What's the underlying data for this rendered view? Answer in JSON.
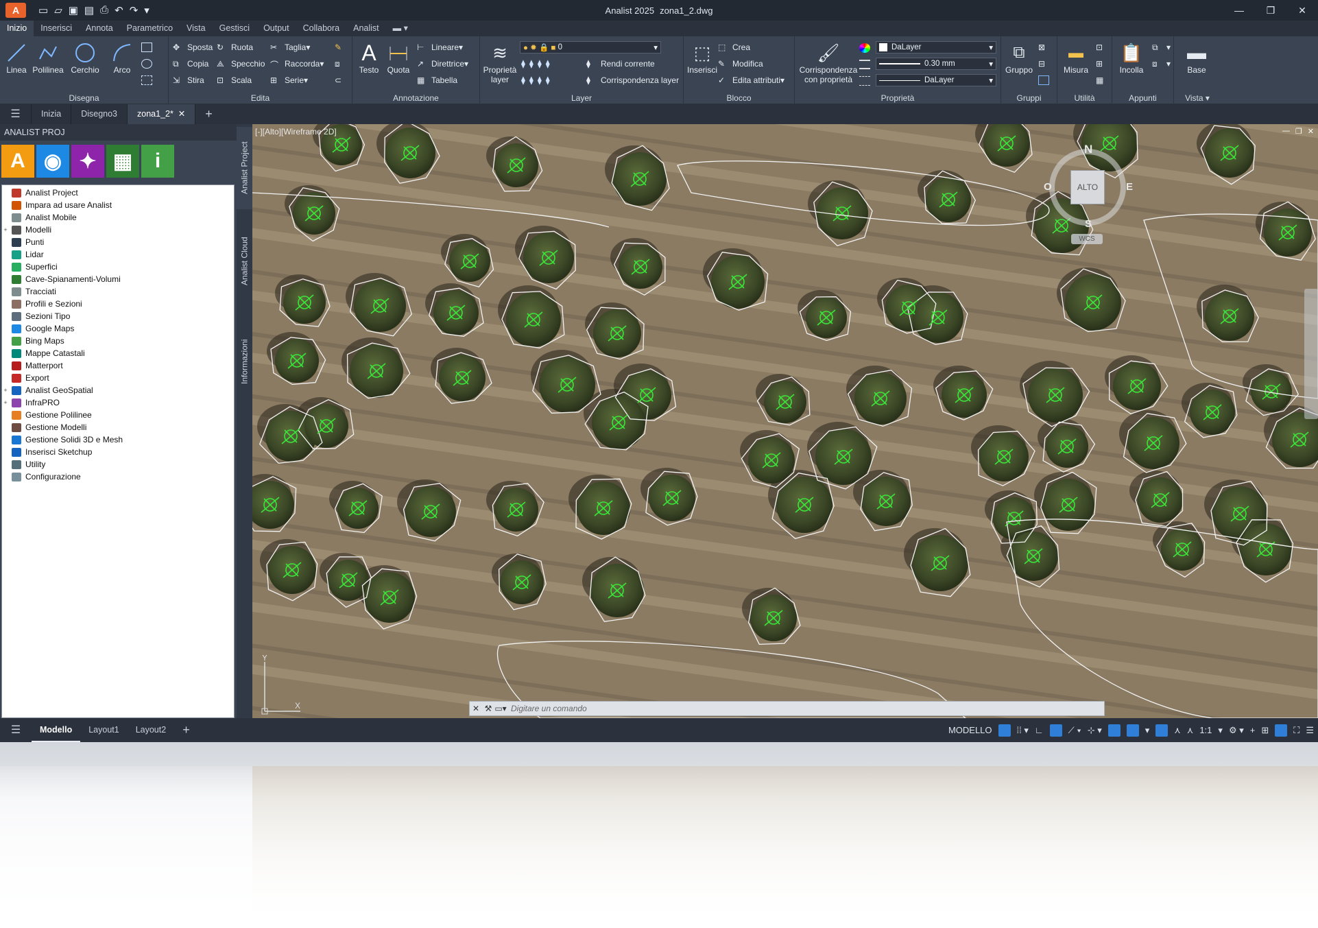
{
  "window": {
    "app_title": "Analist 2025",
    "file_name": "zona1_2.dwg"
  },
  "menu": {
    "tabs": [
      "Inizio",
      "Inserisci",
      "Annota",
      "Parametrico",
      "Vista",
      "Gestisci",
      "Output",
      "Collabora",
      "Analist"
    ]
  },
  "ribbon": {
    "draw": {
      "title": "Disegna",
      "linea": "Linea",
      "polilinea": "Polilinea",
      "cerchio": "Cerchio",
      "arco": "Arco"
    },
    "edit": {
      "title": "Edita",
      "sposta": "Sposta",
      "ruota": "Ruota",
      "taglia": "Taglia",
      "copia": "Copia",
      "specchio": "Specchio",
      "raccorda": "Raccorda",
      "stira": "Stira",
      "scala": "Scala",
      "serie": "Serie"
    },
    "annotation": {
      "title": "Annotazione",
      "testo": "Testo",
      "quota": "Quota",
      "lineare": "Lineare",
      "direttrice": "Direttrice",
      "tabella": "Tabella"
    },
    "layer": {
      "title": "Layer",
      "proprieta_layer_1": "Proprietà",
      "proprieta_layer_2": "layer",
      "current": "0",
      "rendi_corrente": "Rendi corrente",
      "corrispondenza": "Corrispondenza layer"
    },
    "block": {
      "title": "Blocco",
      "inserisci": "Inserisci",
      "crea": "Crea",
      "modifica": "Modifica",
      "edita_attributi": "Edita attributi"
    },
    "props": {
      "title": "Proprietà",
      "corr_1": "Corrispondenza",
      "corr_2": "con proprietà",
      "color": "DaLayer",
      "lineweight": "0.30 mm",
      "linetype": "DaLayer"
    },
    "groups": {
      "title": "Gruppi",
      "gruppo": "Gruppo"
    },
    "utility": {
      "title": "Utilità",
      "misura": "Misura"
    },
    "clipboard": {
      "title": "Appunti",
      "incolla": "Incolla"
    },
    "view": {
      "title": "Vista",
      "base": "Base"
    }
  },
  "doctabs": [
    "Inizia",
    "Disegno3",
    "zona1_2*"
  ],
  "leftpanel": {
    "title": "ANALIST PROJ",
    "tree": [
      {
        "label": "Analist Project",
        "color": "#c0392b",
        "expand": ""
      },
      {
        "label": "Impara ad usare Analist",
        "color": "#d35400",
        "expand": ""
      },
      {
        "label": "Analist Mobile",
        "color": "#7f8c8d",
        "expand": ""
      },
      {
        "label": "Modelli",
        "color": "#555555",
        "expand": "+"
      },
      {
        "label": "Punti",
        "color": "#2c3e50",
        "expand": ""
      },
      {
        "label": "Lidar",
        "color": "#16a085",
        "expand": ""
      },
      {
        "label": "Superfici",
        "color": "#27ae60",
        "expand": ""
      },
      {
        "label": "Cave-Spianamenti-Volumi",
        "color": "#2e7d32",
        "expand": ""
      },
      {
        "label": "Tracciati",
        "color": "#7f8c8d",
        "expand": ""
      },
      {
        "label": "Profili e Sezioni",
        "color": "#8d6e63",
        "expand": ""
      },
      {
        "label": "Sezioni Tipo",
        "color": "#5d6d7e",
        "expand": ""
      },
      {
        "label": "Google Maps",
        "color": "#1e88e5",
        "expand": ""
      },
      {
        "label": "Bing Maps",
        "color": "#43a047",
        "expand": ""
      },
      {
        "label": "Mappe Catastali",
        "color": "#00897b",
        "expand": ""
      },
      {
        "label": "Matterport",
        "color": "#b71c1c",
        "expand": ""
      },
      {
        "label": "Export",
        "color": "#c62828",
        "expand": ""
      },
      {
        "label": "Analist GeoSpatial",
        "color": "#1565c0",
        "expand": "+"
      },
      {
        "label": "InfraPRO",
        "color": "#8e44ad",
        "expand": "+"
      },
      {
        "label": "Gestione Polilinee",
        "color": "#e67e22",
        "expand": ""
      },
      {
        "label": "Gestione Modelli",
        "color": "#6d4c41",
        "expand": ""
      },
      {
        "label": "Gestione Solidi 3D e Mesh",
        "color": "#1976d2",
        "expand": ""
      },
      {
        "label": "Inserisci Sketchup",
        "color": "#1565c0",
        "expand": ""
      },
      {
        "label": "Utility",
        "color": "#546e7a",
        "expand": ""
      },
      {
        "label": "Configurazione",
        "color": "#78909c",
        "expand": ""
      }
    ],
    "icons": [
      {
        "name": "analist-a-icon",
        "label": "A",
        "color": "#f39c12"
      },
      {
        "name": "globe-icon",
        "label": "◉",
        "color": "#1e88e5"
      },
      {
        "name": "satellite-icon",
        "label": "✦",
        "color": "#8e24aa"
      },
      {
        "name": "map-icon",
        "label": "▦",
        "color": "#2e7d32"
      },
      {
        "name": "info-icon",
        "label": "i",
        "color": "#43a047"
      }
    ]
  },
  "sidetabs": [
    "Analist Project",
    "Analist Cloud",
    "Informazioni"
  ],
  "viewport": {
    "label": "[-][Alto][Wireframe 2D]",
    "compass_top": "N",
    "compass_bottom": "S",
    "compass_left": "O",
    "compass_right": "E",
    "cube_face": "ALTO",
    "ucs": "WCS"
  },
  "cmdline": {
    "placeholder": "Digitare un comando"
  },
  "statusbar": {
    "layouts": [
      "Modello",
      "Layout1",
      "Layout2"
    ],
    "space": "MODELLO",
    "scale": "1:1"
  }
}
